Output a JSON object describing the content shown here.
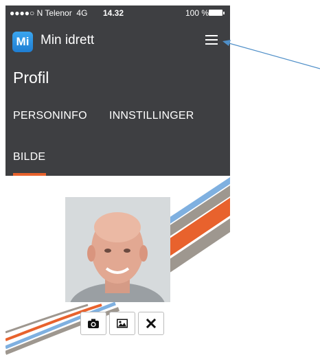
{
  "statusbar": {
    "carrier": "●●●●○ N Telenor",
    "network": "4G",
    "time": "14.32",
    "battery": "100 %"
  },
  "appbar": {
    "logo_text": "Mi",
    "title": "Min idrett",
    "menu_icon": "hamburger-menu-icon"
  },
  "page": {
    "title": "Profil"
  },
  "tabs": [
    {
      "label": "PERSONINFO",
      "active": false
    },
    {
      "label": "INNSTILLINGER",
      "active": false
    },
    {
      "label": "BILDE",
      "active": true
    }
  ],
  "photo_actions": [
    {
      "icon": "camera-icon"
    },
    {
      "icon": "image-icon"
    },
    {
      "icon": "close-icon"
    }
  ],
  "colors": {
    "header_bg": "#3e3f42",
    "accent": "#e8622d",
    "logo_blue": "#2a8fe0",
    "stripe_blue": "#7fb0e0",
    "stripe_gray": "#9e978f",
    "arrow": "#4f8fc8"
  }
}
